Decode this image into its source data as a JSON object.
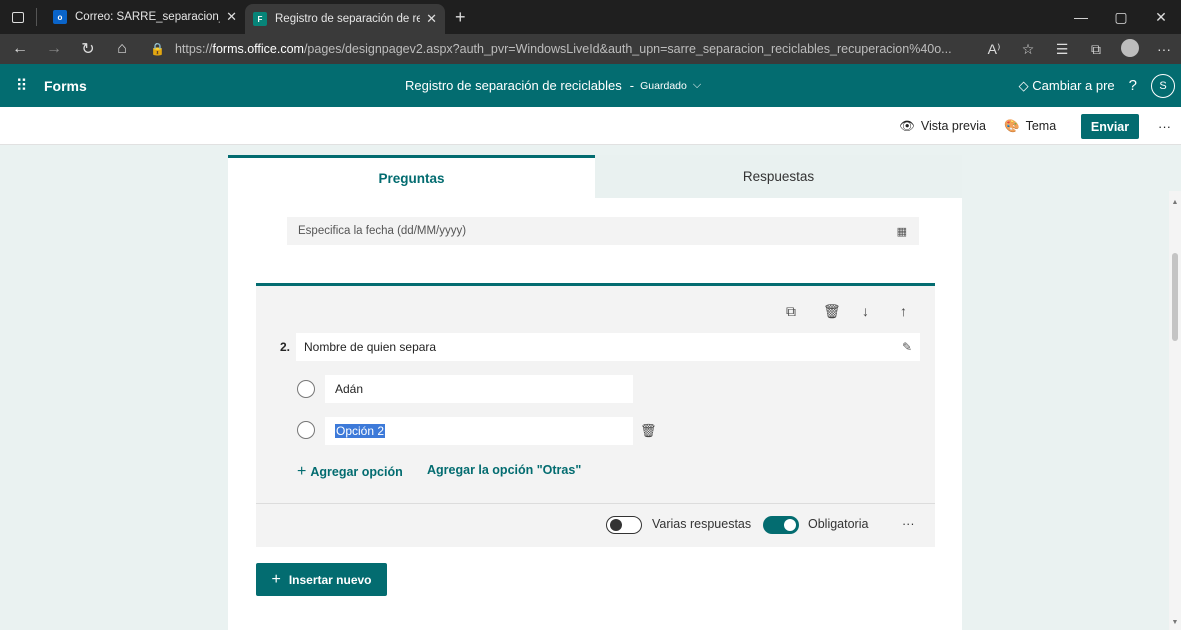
{
  "browser": {
    "tabs": [
      {
        "title": "Correo: SARRE_separacion_recicl",
        "close": "✕",
        "icon": "outlook-icon"
      },
      {
        "title": "Registro de separación de recicla",
        "close": "✕",
        "icon": "forms-icon"
      }
    ],
    "new_tab": "+",
    "url_prefix": "https://",
    "url_domain": "forms.office.com",
    "url_rest": "/pages/designpagev2.aspx?auth_pvr=WindowsLiveId&auth_upn=sarre_separacion_reciclables_recuperacion%40o...",
    "controls": {
      "minimize": "—",
      "maximize": "▢",
      "close": "✕"
    }
  },
  "forms_header": {
    "app_name": "Forms",
    "form_title": "Registro de separación de reciclables",
    "separator": "-",
    "saved_status": "Guardado",
    "upgrade_label": "Cambiar a pre",
    "help": "?",
    "user_initial": "S"
  },
  "commands": {
    "preview": "Vista previa",
    "theme": "Tema",
    "send": "Enviar",
    "more": "···"
  },
  "panel_tabs": {
    "questions": "Preguntas",
    "responses": "Respuestas"
  },
  "date_question": {
    "placeholder": "Especifica la fecha (dd/MM/yyyy)"
  },
  "question": {
    "number": "2.",
    "title": "Nombre de quien separa",
    "options": [
      "Adán",
      "Opción 2"
    ],
    "add_option": "Agregar opción",
    "add_other": "Agregar la opción \"Otras\"",
    "multiple_answers_label": "Varias respuestas",
    "multiple_answers": false,
    "required_label": "Obligatoria",
    "required": true,
    "more": "···"
  },
  "insert_new": "Insertar nuevo",
  "colors": {
    "brand": "#036c70",
    "selection": "#3d7ad9"
  }
}
